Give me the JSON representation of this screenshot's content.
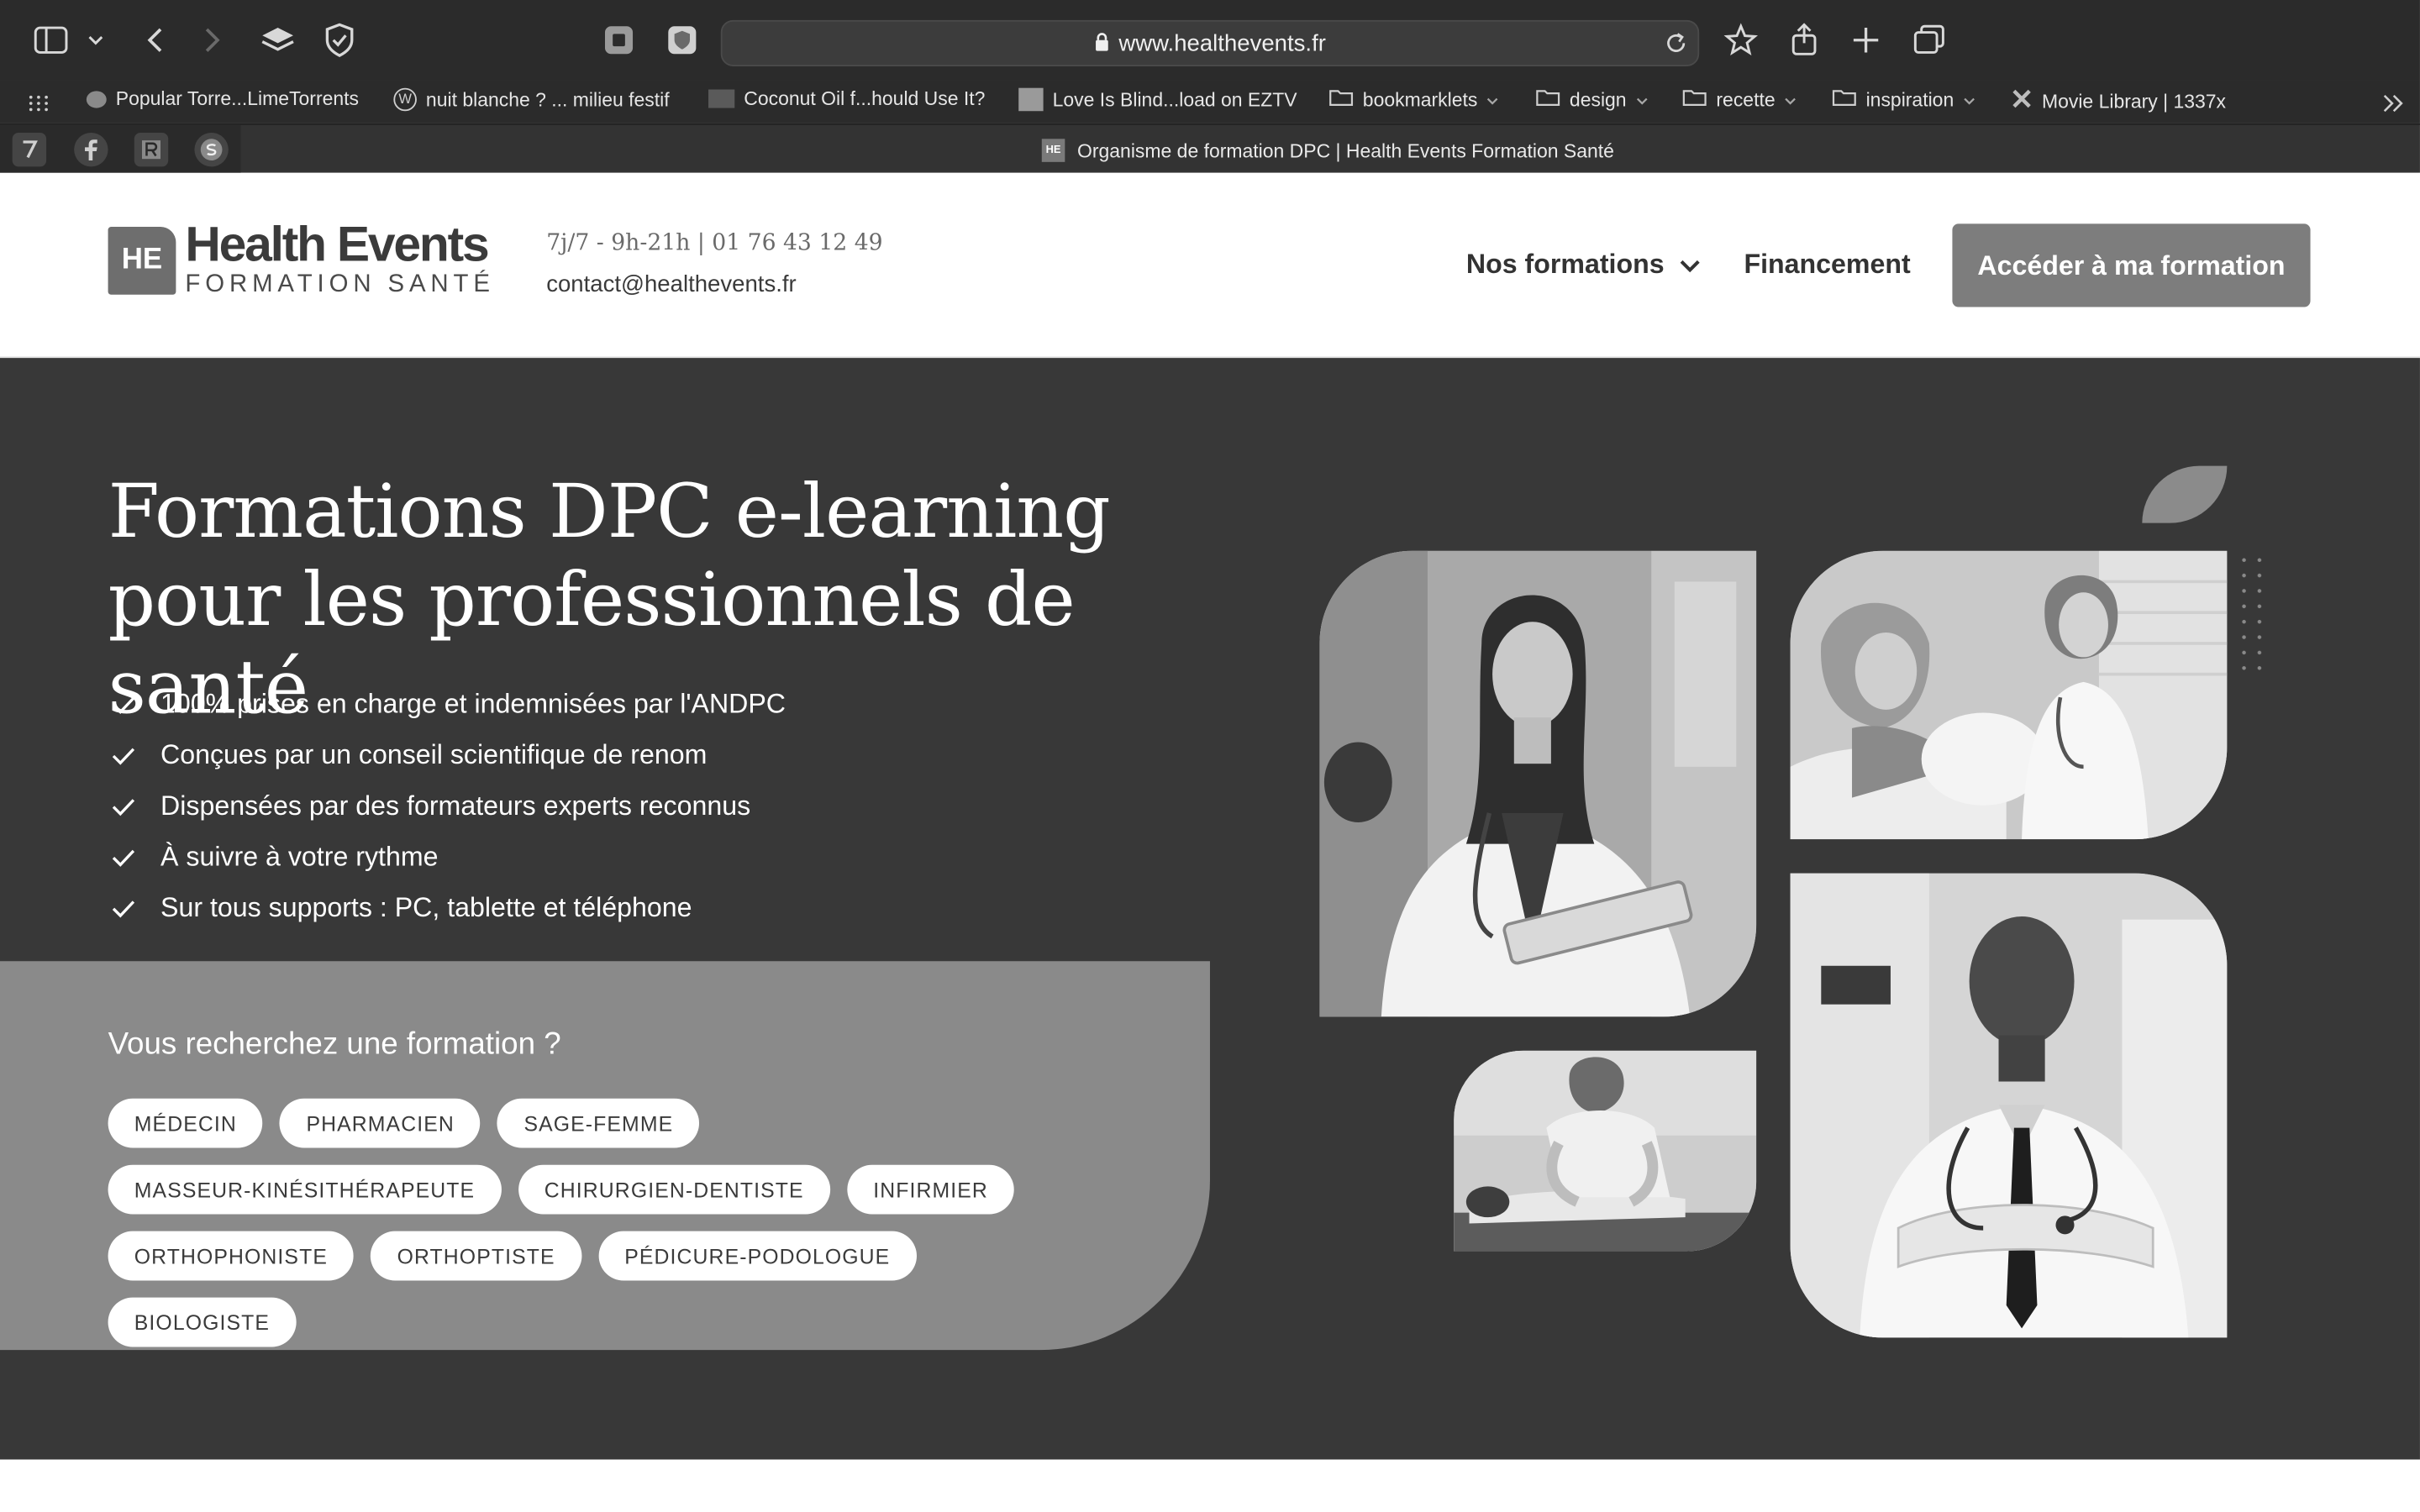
{
  "browser": {
    "url": "www.healthevents.fr",
    "bookmarks": [
      {
        "label": "Popular Torre...LimeTorrents"
      },
      {
        "label": "nuit blanche ? ... milieu festif"
      },
      {
        "label": "Coconut Oil f...hould Use It?"
      },
      {
        "label": "Love Is Blind...load on EZTV"
      },
      {
        "label": "bookmarklets"
      },
      {
        "label": "design"
      },
      {
        "label": "recette"
      },
      {
        "label": "inspiration"
      },
      {
        "label": "Movie Library | 1337x"
      }
    ],
    "tab_title": "Organisme de formation DPC | Health Events Formation Santé"
  },
  "header": {
    "logo_mark": "HE",
    "logo_name": "Health Events",
    "logo_sub": "FORMATION SANTÉ",
    "hours": "7j/7 - 9h-21h | 01 76 43 12 49",
    "email": "contact@healthevents.fr",
    "nav": {
      "formations": "Nos formations",
      "financement": "Financement",
      "cta": "Accéder à ma formation"
    }
  },
  "hero": {
    "title": "Formations DPC e-learning pour les professionnels de santé",
    "bullets": [
      "100% prises en charge et indemnisées par l'ANDPC",
      "Conçues par un conseil scientifique de renom",
      "Dispensées par des formateurs experts reconnus",
      "À suivre à votre rythme",
      "Sur tous supports : PC, tablette et téléphone"
    ],
    "search_question": "Vous recherchez une formation ?",
    "professions": [
      "MÉDECIN",
      "PHARMACIEN",
      "SAGE-FEMME",
      "MASSEUR-KINÉSITHÉRAPEUTE",
      "CHIRURGIEN-DENTISTE",
      "INFIRMIER",
      "ORTHOPHONISTE",
      "ORTHOPTISTE",
      "PÉDICURE-PODOLOGUE",
      "BIOLOGISTE"
    ]
  }
}
